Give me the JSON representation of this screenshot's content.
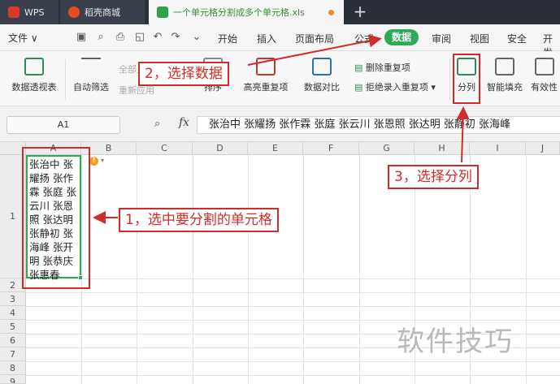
{
  "tabs": {
    "wps": "WPS",
    "mall": "稻壳商城",
    "file": "一个单元格分割成多个单元格.xls",
    "new_tab": "+"
  },
  "menu": {
    "file": "文件 ∨",
    "items": [
      "开始",
      "插入",
      "页面布局",
      "公式",
      "数据",
      "审阅",
      "视图",
      "安全",
      "开发"
    ],
    "active": "数据"
  },
  "ribbon": {
    "pivot": "数据透视表",
    "autofilter": "自动筛选",
    "show_all": "全部显示",
    "reapply": "重新应用",
    "sort": "排序",
    "highlight_dup": "高亮重复项",
    "compare": "数据对比",
    "remove_dup": "删除重复项",
    "reject_dup": "拒绝录入重复项",
    "split": "分列",
    "smart_fill": "智能填充",
    "validity": "有效性"
  },
  "formula_bar": {
    "cell_ref": "A1",
    "fx": "fx",
    "content": "张治中 张耀扬 张作霖 张庭 张云川 张恩照 张达明 张静初 张海峰"
  },
  "grid": {
    "columns": [
      "A",
      "B",
      "C",
      "D",
      "E",
      "F",
      "G",
      "H",
      "I",
      "J"
    ],
    "rows": [
      "1",
      "2",
      "3",
      "4",
      "5",
      "6",
      "7",
      "8",
      "9"
    ],
    "a1_value": " 张治中 张耀扬 张作霖 张庭 张云川 张恩照 张达明 张静初 张海峰 张开明 张恭庆 张惠春"
  },
  "annotations": {
    "step1": "1，选中要分割的单元格",
    "step2": "2，选择数据",
    "step3": "3，选择分列"
  },
  "watermark": "软件技巧",
  "colors": {
    "accent_green": "#2eaa5a",
    "annotation_red": "#d12b2b"
  }
}
